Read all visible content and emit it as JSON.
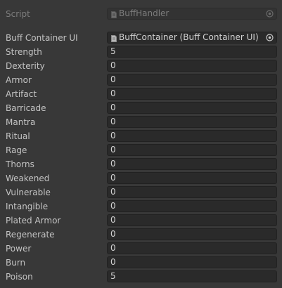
{
  "script": {
    "label": "Script",
    "value": "BuffHandler"
  },
  "buff_container": {
    "label": "Buff Container UI",
    "value": "BuffContainer (Buff Container UI)"
  },
  "fields": [
    {
      "label": "Strength",
      "value": "5"
    },
    {
      "label": "Dexterity",
      "value": "0"
    },
    {
      "label": "Armor",
      "value": "0"
    },
    {
      "label": "Artifact",
      "value": "0"
    },
    {
      "label": "Barricade",
      "value": "0"
    },
    {
      "label": "Mantra",
      "value": "0"
    },
    {
      "label": "Ritual",
      "value": "0"
    },
    {
      "label": "Rage",
      "value": "0"
    },
    {
      "label": "Thorns",
      "value": "0"
    },
    {
      "label": "Weakened",
      "value": "0"
    },
    {
      "label": "Vulnerable",
      "value": "0"
    },
    {
      "label": "Intangible",
      "value": "0"
    },
    {
      "label": "Plated Armor",
      "value": "0"
    },
    {
      "label": "Regenerate",
      "value": "0"
    },
    {
      "label": "Power",
      "value": "0"
    },
    {
      "label": "Burn",
      "value": "0"
    },
    {
      "label": "Poison",
      "value": "5"
    }
  ],
  "icons": {
    "script_object": "script-file-icon",
    "container_object": "gameobject-icon",
    "picker": "object-picker-icon"
  },
  "colors": {
    "background": "#383838",
    "field_background": "#2a2a2a",
    "text": "#c4c4c4",
    "disabled_text": "#7d7d7d"
  }
}
